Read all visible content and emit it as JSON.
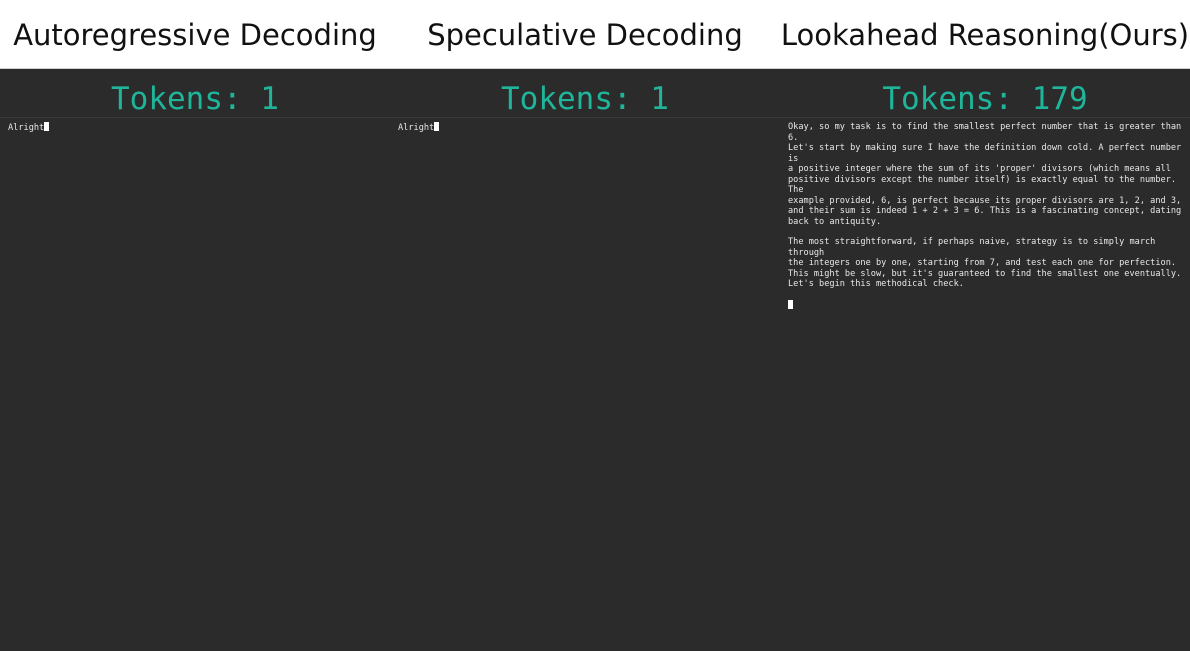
{
  "header": {
    "titles": [
      "Autoregressive Decoding",
      "Speculative Decoding",
      "Lookahead Reasoning(Ours)"
    ]
  },
  "panels": [
    {
      "token_label": "Tokens: 1",
      "text": "Alright"
    },
    {
      "token_label": "Tokens: 1",
      "text": "Alright"
    },
    {
      "token_label": "Tokens: 179",
      "paragraphs": [
        "Okay, so my task is to find the smallest perfect number that is greater than 6.\nLet's start by making sure I have the definition down cold. A perfect number is\na positive integer where the sum of its 'proper' divisors (which means all\npositive divisors except the number itself) is exactly equal to the number. The\nexample provided, 6, is perfect because its proper divisors are 1, 2, and 3,\nand their sum is indeed 1 + 2 + 3 = 6. This is a fascinating concept, dating\nback to antiquity.",
        "The most straightforward, if perhaps naive, strategy is to simply march through\nthe integers one by one, starting from 7, and test each one for perfection.\nThis might be slow, but it's guaranteed to find the smallest one eventually.\nLet's begin this methodical check."
      ]
    }
  ],
  "colors": {
    "accent": "#1fb59a",
    "panel_bg": "#2b2b2b",
    "text": "#e8e8e8",
    "header_bg": "#ffffff"
  },
  "icons": {
    "cursor": "text-cursor-block"
  }
}
